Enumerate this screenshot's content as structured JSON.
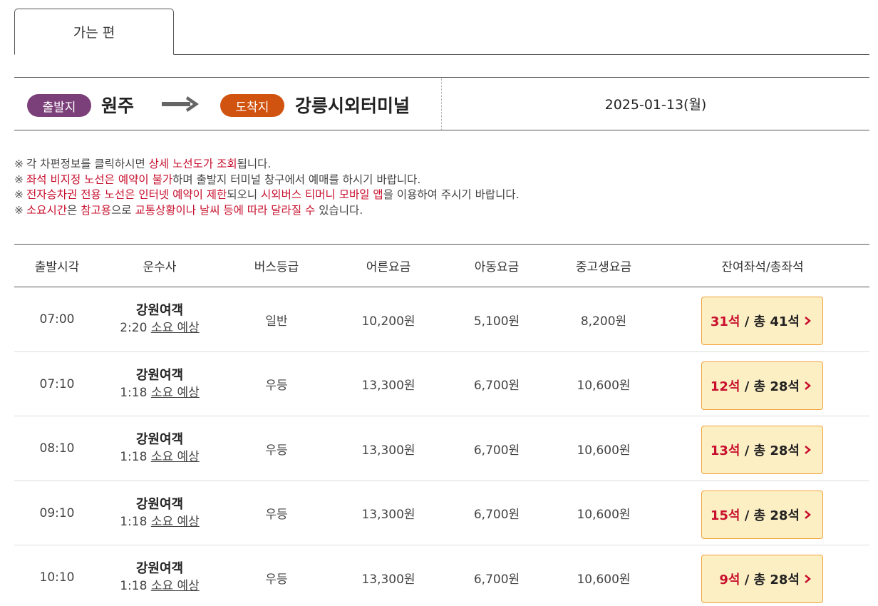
{
  "tab": {
    "label": "가는 편"
  },
  "route": {
    "departure_label": "출발지",
    "departure_place": "원주",
    "arrival_label": "도착지",
    "arrival_place": "강릉시외터미널",
    "date": "2025-01-13(월)"
  },
  "notices": [
    {
      "segments": [
        {
          "text": "각 차편정보를 클릭하시면 ",
          "red": false
        },
        {
          "text": "상세 노선도가 조회",
          "red": true
        },
        {
          "text": "됩니다.",
          "red": false
        }
      ]
    },
    {
      "segments": [
        {
          "text": "좌석 비지정 노선은 예약이 불가",
          "red": true
        },
        {
          "text": "하며 출발지 터미널 창구에서 예매를 하시기 바랍니다.",
          "red": false
        }
      ]
    },
    {
      "segments": [
        {
          "text": "전자승차권 전용 노선은 인터넷 예약이 제한",
          "red": true
        },
        {
          "text": "되오니 ",
          "red": false
        },
        {
          "text": "시외버스 티머니 모바일 앱",
          "red": true
        },
        {
          "text": "을 이용하여 주시기 바랍니다.",
          "red": false
        }
      ]
    },
    {
      "segments": [
        {
          "text": "소요시간",
          "red": true
        },
        {
          "text": "은 ",
          "red": false
        },
        {
          "text": "참고용",
          "red": true
        },
        {
          "text": "으로 ",
          "red": false
        },
        {
          "text": "교통상황이나 날씨 등에 따라 달라질 수",
          "red": true
        },
        {
          "text": " 있습니다.",
          "red": false
        }
      ]
    }
  ],
  "notice_mark": "※",
  "table": {
    "headers": {
      "time": "출발시각",
      "company": "운수사",
      "grade": "버스등급",
      "adult": "어른요금",
      "child": "아동요금",
      "student": "중고생요금",
      "seats": "잔여좌석/총좌석"
    },
    "rows": [
      {
        "time": "07:00",
        "company": "강원여객",
        "duration": "2:20",
        "duration_suffix": "소요 예상",
        "grade": "일반",
        "adult": "10,200원",
        "child": "5,100원",
        "student": "8,200원",
        "remain": "31석",
        "total": "/ 총 41석"
      },
      {
        "time": "07:10",
        "company": "강원여객",
        "duration": "1:18",
        "duration_suffix": "소요 예상",
        "grade": "우등",
        "adult": "13,300원",
        "child": "6,700원",
        "student": "10,600원",
        "remain": "12석",
        "total": "/ 총 28석"
      },
      {
        "time": "08:10",
        "company": "강원여객",
        "duration": "1:18",
        "duration_suffix": "소요 예상",
        "grade": "우등",
        "adult": "13,300원",
        "child": "6,700원",
        "student": "10,600원",
        "remain": "13석",
        "total": "/ 총 28석"
      },
      {
        "time": "09:10",
        "company": "강원여객",
        "duration": "1:18",
        "duration_suffix": "소요 예상",
        "grade": "우등",
        "adult": "13,300원",
        "child": "6,700원",
        "student": "10,600원",
        "remain": "15석",
        "total": "/ 총 28석"
      },
      {
        "time": "10:10",
        "company": "강원여객",
        "duration": "1:18",
        "duration_suffix": "소요 예상",
        "grade": "우등",
        "adult": "13,300원",
        "child": "6,700원",
        "student": "10,600원",
        "remain": "9석",
        "total": "/ 총 28석"
      }
    ]
  },
  "colors": {
    "departure_pill": "#7b3f7a",
    "arrival_pill": "#d0530f",
    "highlight_red": "#c8102e",
    "seat_button_bg": "#fdefc4",
    "seat_button_border": "#f0a23c"
  },
  "icons": {
    "route_arrow": "right-arrow-icon",
    "seat_chevron": "chevron-right-icon"
  }
}
